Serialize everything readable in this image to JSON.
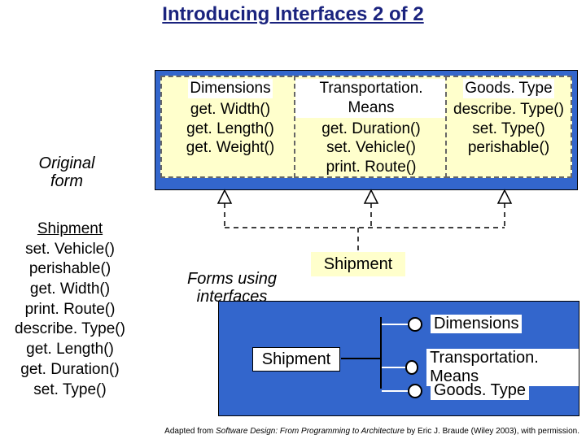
{
  "title": "Introducing Interfaces 2 of 2",
  "captions": {
    "original": "Original form",
    "forms": "Forms using interfaces"
  },
  "interfaces": [
    {
      "name": "Dimensions",
      "methods": [
        "get. Width()",
        "get. Length()",
        "get. Weight()"
      ]
    },
    {
      "name": "Transportation. Means",
      "methods": [
        "get. Duration()",
        "set. Vehicle()",
        "print. Route()"
      ]
    },
    {
      "name": "Goods. Type",
      "methods": [
        "describe. Type()",
        "set. Type()",
        "perishable()"
      ]
    }
  ],
  "shipment": {
    "name": "Shipment",
    "methods": [
      "set. Vehicle()",
      "perishable()",
      "get. Width()",
      "print. Route()",
      "describe. Type()",
      "get. Length()",
      "get. Duration()",
      "set. Type()"
    ]
  },
  "lollipops": [
    {
      "label": "Dimensions"
    },
    {
      "label": "Transportation. Means"
    },
    {
      "label": "Goods. Type"
    }
  ],
  "shipment_label_small": "Shipment",
  "footnote_pre": "Adapted from ",
  "footnote_title": "Software Design: From Programming to Architecture",
  "footnote_post": " by Eric J. Braude (Wiley 2003), with permission."
}
